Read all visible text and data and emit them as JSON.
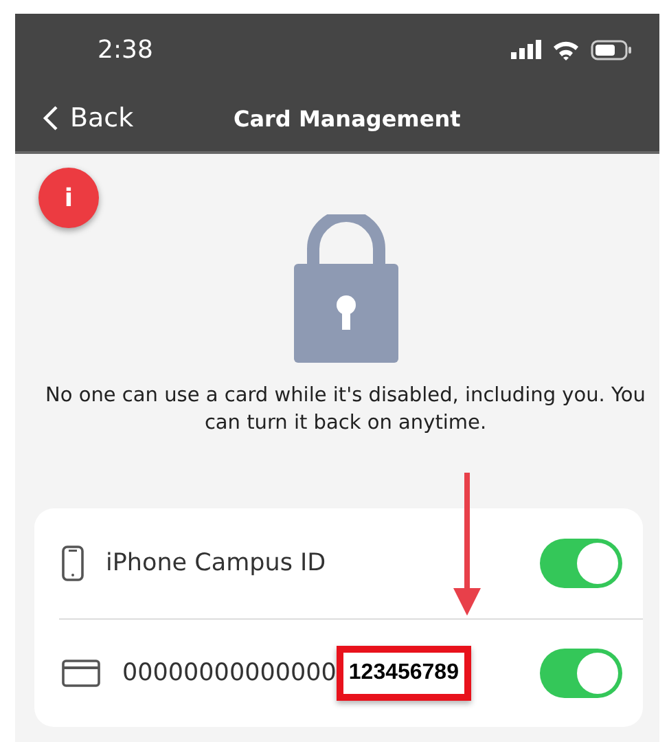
{
  "status_bar": {
    "time": "2:38"
  },
  "nav": {
    "back": "Back",
    "title": "Card Management"
  },
  "info_badge": {
    "label": "i"
  },
  "message": "No one can use a card while it's disabled, including you. You can turn it back on anytime.",
  "cards": [
    {
      "kind": "phone",
      "name": "iPhone Campus ID",
      "on": true
    },
    {
      "kind": "card",
      "name": "00000000000000",
      "highlight": "123456789",
      "on": true
    }
  ]
}
